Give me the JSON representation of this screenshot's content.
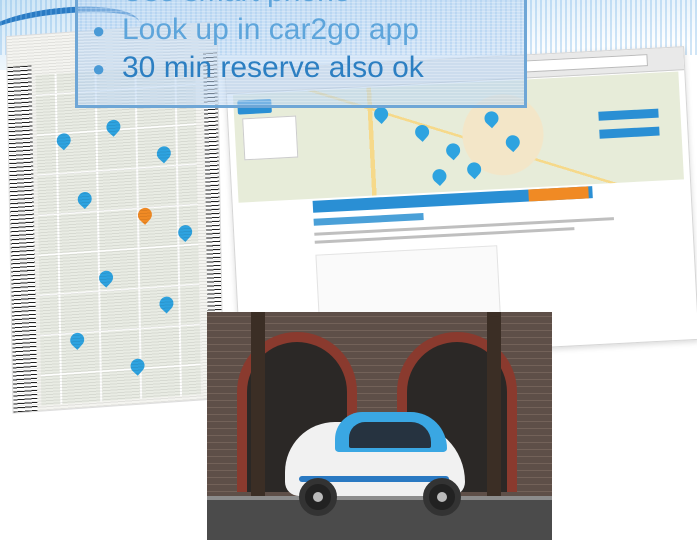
{
  "slide": {
    "bullets": [
      "Use smart phone",
      "Look up in car2go app",
      "30 min reserve also ok"
    ]
  },
  "images": {
    "phone_map": "car2go-app-map-screenshot",
    "browser_map": "car2go-website-map-screenshot",
    "car": "car2go-smart-fortwo-photo"
  },
  "colors": {
    "accent_blue": "#2c7fc2",
    "car2go_blue": "#3aa7e3",
    "orange": "#f08a24"
  }
}
